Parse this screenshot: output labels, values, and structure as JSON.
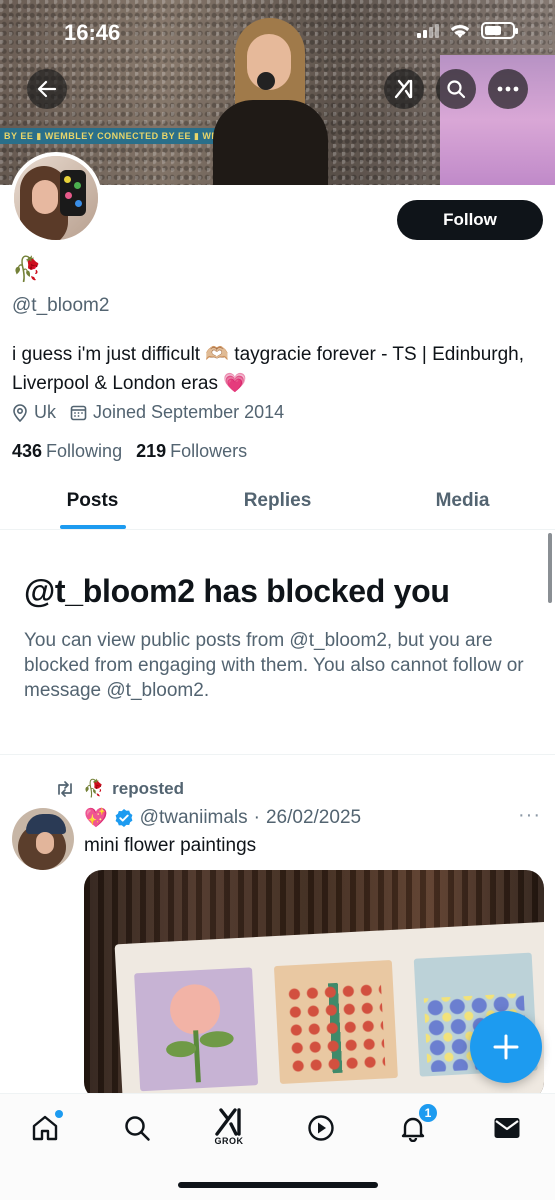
{
  "status_bar": {
    "time": "16:46"
  },
  "banner": {
    "stripe_text": "BY EE ▮ WEMBLEY  CONNECTED BY EE ▮ WEMBLEY"
  },
  "header_buttons": {
    "back_icon": "arrow-left-icon",
    "grok_icon": "grok-icon",
    "search_icon": "search-icon",
    "more_icon": "more-icon"
  },
  "profile": {
    "display_name": "🥀",
    "handle": "@t_bloom2",
    "bio": "i guess i'm just difficult 🫶🏼 taygracie forever - TS | Edinburgh, Liverpool & London eras 💗",
    "location": "Uk",
    "joined": "Joined September 2014",
    "following_count": "436",
    "following_label": "Following",
    "followers_count": "219",
    "followers_label": "Followers",
    "follow_label": "Follow"
  },
  "tabs": [
    {
      "label": "Posts",
      "active": true
    },
    {
      "label": "Replies",
      "active": false
    },
    {
      "label": "Media",
      "active": false
    }
  ],
  "blocked_notice": {
    "title": "@t_bloom2 has blocked you",
    "text": "You can view public posts from @t_bloom2, but you are blocked from engaging with them. You also cannot follow or message @t_bloom2."
  },
  "post": {
    "repost_emoji": "🥀",
    "repost_label": "reposted",
    "author_emoji": "💖",
    "author_handle": "@twaniimals",
    "separator": "·",
    "date": "26/02/2025",
    "more": "···",
    "text": "mini flower paintings"
  },
  "bottom_nav": {
    "items": [
      "home-icon",
      "search-icon",
      "grok-icon",
      "video-icon",
      "notifications-icon",
      "messages-icon"
    ],
    "grok_label": "GROK",
    "notification_badge": "1"
  },
  "colors": {
    "accent": "#1d9bf0",
    "text": "#0f1419",
    "muted": "#536471"
  }
}
